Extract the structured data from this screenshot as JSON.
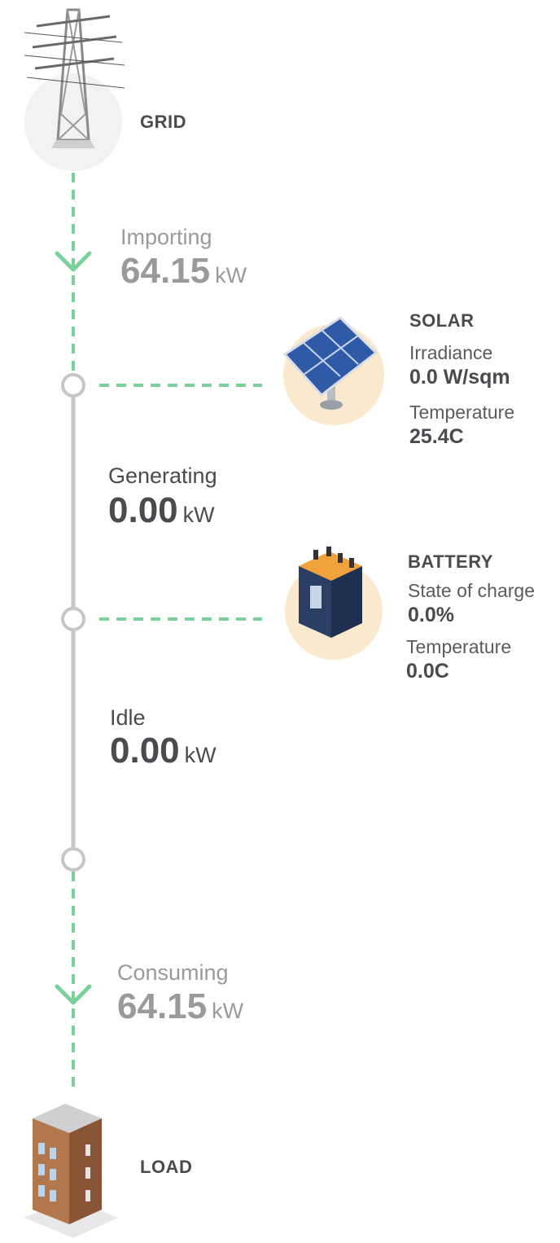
{
  "grid": {
    "title": "GRID"
  },
  "importing": {
    "label": "Importing",
    "value": "64.15",
    "unit": "kW"
  },
  "solar": {
    "title": "SOLAR",
    "irradiance_label": "Irradiance",
    "irradiance_value": "0.0 W/sqm",
    "temperature_label": "Temperature",
    "temperature_value": "25.4C"
  },
  "generating": {
    "label": "Generating",
    "value": "0.00",
    "unit": "kW"
  },
  "battery": {
    "title": "BATTERY",
    "soc_label": "State of charge",
    "soc_value": "0.0%",
    "temperature_label": "Temperature",
    "temperature_value": "0.0C"
  },
  "idle": {
    "label": "Idle",
    "value": "0.00",
    "unit": "kW"
  },
  "consuming": {
    "label": "Consuming",
    "value": "64.15",
    "unit": "kW"
  },
  "load": {
    "title": "LOAD"
  },
  "colors": {
    "flow_green": "#7ad19a",
    "line_gray": "#c6c6c6",
    "circle_bg_grid": "#f2f2f2",
    "circle_bg_peach": "#fbe9cf"
  }
}
